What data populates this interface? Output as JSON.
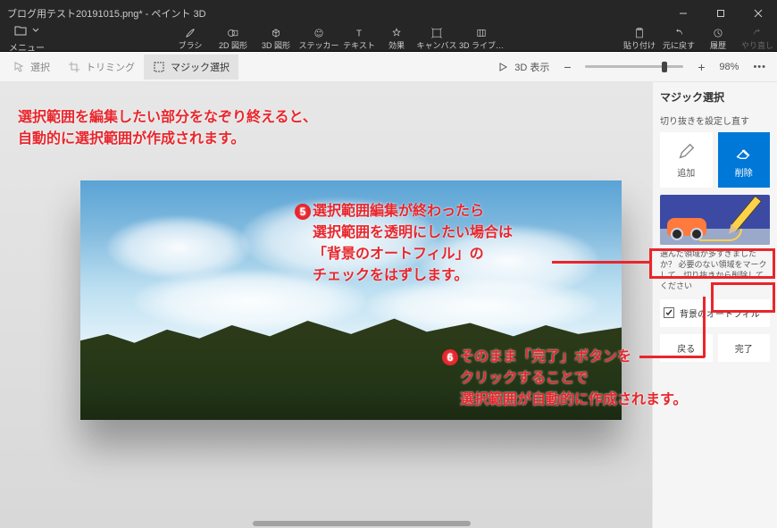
{
  "window": {
    "title": "ブログ用テスト20191015.png* - ペイント 3D"
  },
  "menubar": {
    "menu_label": "メニュー",
    "tools": [
      {
        "id": "brush",
        "label": "ブラシ"
      },
      {
        "id": "shape2d",
        "label": "2D 図形"
      },
      {
        "id": "shape3d",
        "label": "3D 図形"
      },
      {
        "id": "sticker",
        "label": "ステッカー"
      },
      {
        "id": "text",
        "label": "テキスト"
      },
      {
        "id": "effects",
        "label": "効果"
      },
      {
        "id": "canvas",
        "label": "キャンバス"
      },
      {
        "id": "lib3d",
        "label": "3D ライブ…"
      }
    ],
    "right": {
      "paste": "貼り付け",
      "undo": "元に戻す",
      "history": "履歴",
      "redo": "やり直し"
    }
  },
  "secondbar": {
    "select": "選択",
    "trimming": "トリミング",
    "magic_select": "マジック選択",
    "view3d": "3D 表示",
    "zoom_pct": "98%"
  },
  "rpanel": {
    "title": "マジック選択",
    "sub": "切り抜きを設定し直す",
    "add": "追加",
    "remove": "削除",
    "hint": "選んだ領域が多すぎましたか？ 必要のない領域をマークして、切り抜きから削除してください",
    "autofill": "背景のオートフィル",
    "autofill_checked": true,
    "back": "戻る",
    "done": "完了"
  },
  "annotations": {
    "a1_line1": "選択範囲を編集したい部分をなぞり終えると、",
    "a1_line2": "自動的に選択範囲が作成されます。",
    "a2_num": "5",
    "a2_line1": "選択範囲編集が終わったら",
    "a2_line2": "選択範囲を透明にしたい場合は",
    "a2_line3": "「背景のオートフィル」の",
    "a2_line4": "チェックをはずします。",
    "a3_num": "6",
    "a3_line1": "そのまま「完了」ボタンを",
    "a3_line2": "クリックすることで",
    "a3_line3": "選択範囲が自動的に作成されます。"
  },
  "colors": {
    "accent": "#0078d7",
    "annotation": "#e8262c"
  }
}
